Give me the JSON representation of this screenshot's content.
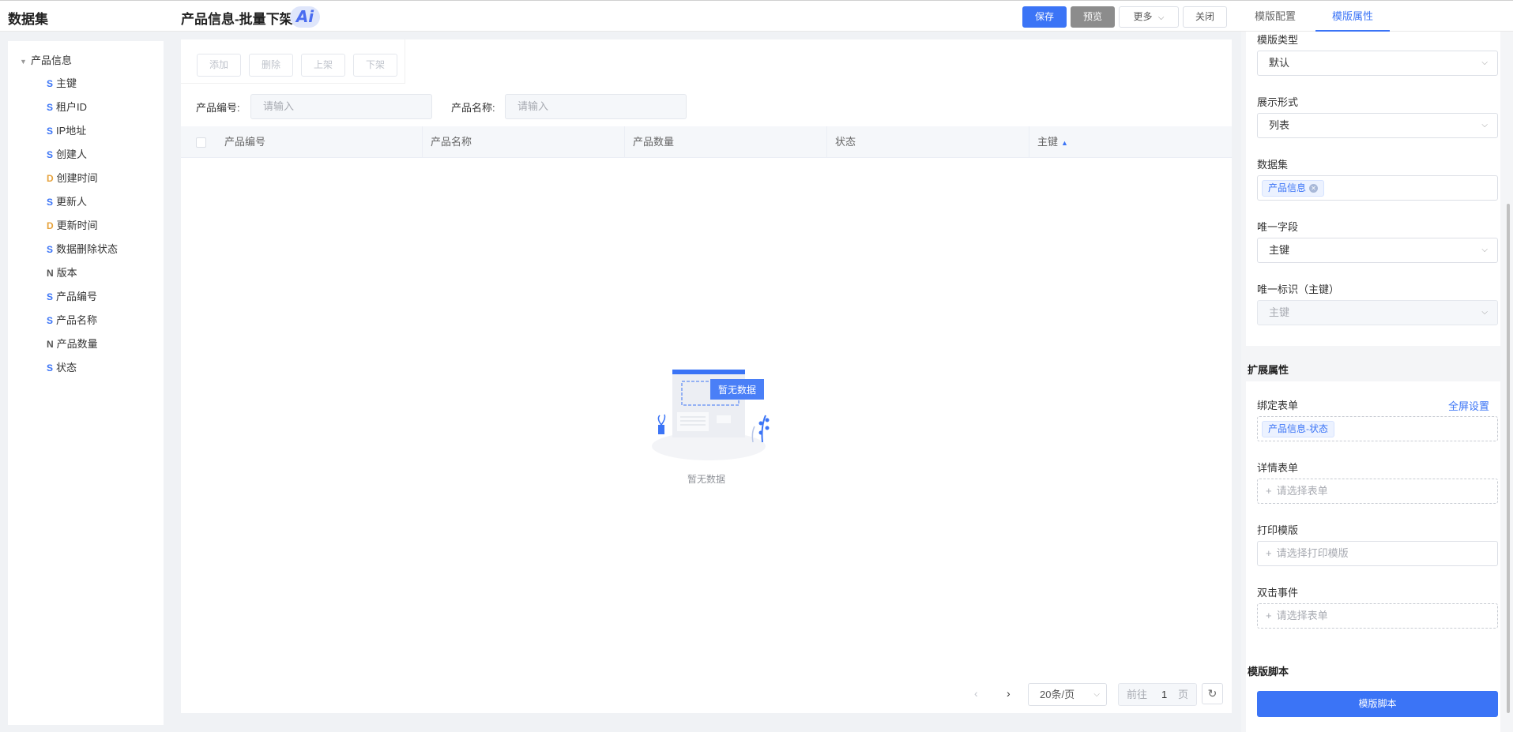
{
  "header": {
    "app_title": "数据集",
    "page_title": "产品信息-批量下架",
    "ai_badge": "Ai",
    "buttons": {
      "save": "保存",
      "preview": "预览",
      "more": "更多",
      "close": "关闭"
    },
    "tabs": {
      "config": "模版配置",
      "props": "模版属性"
    }
  },
  "sidebar": {
    "root": "产品信息",
    "items": [
      {
        "type": "S",
        "label": "主键"
      },
      {
        "type": "S",
        "label": "租户ID"
      },
      {
        "type": "S",
        "label": "IP地址"
      },
      {
        "type": "S",
        "label": "创建人"
      },
      {
        "type": "D",
        "label": "创建时间"
      },
      {
        "type": "S",
        "label": "更新人"
      },
      {
        "type": "D",
        "label": "更新时间"
      },
      {
        "type": "S",
        "label": "数据删除状态"
      },
      {
        "type": "N",
        "label": "版本"
      },
      {
        "type": "S",
        "label": "产品编号"
      },
      {
        "type": "S",
        "label": "产品名称"
      },
      {
        "type": "N",
        "label": "产品数量"
      },
      {
        "type": "S",
        "label": "状态"
      }
    ]
  },
  "main": {
    "actions": {
      "add": "添加",
      "delete": "删除",
      "on_shelf": "上架",
      "off_shelf": "下架"
    },
    "filters": {
      "code_label": "产品编号:",
      "code_placeholder": "请输入",
      "name_label": "产品名称:",
      "name_placeholder": "请输入"
    },
    "columns": [
      "产品编号",
      "产品名称",
      "产品数量",
      "状态",
      "主键"
    ],
    "empty": {
      "badge": "暂无数据",
      "text": "暂无数据"
    },
    "pager": {
      "page_size": "20条/页",
      "goto": "前往",
      "page": "1",
      "page_unit": "页"
    }
  },
  "panel": {
    "template_type": {
      "label": "模版类型",
      "value": "默认"
    },
    "display_mode": {
      "label": "展示形式",
      "value": "列表"
    },
    "dataset": {
      "label": "数据集",
      "tag": "产品信息"
    },
    "unique_field": {
      "label": "唯一字段",
      "value": "主键"
    },
    "unique_id": {
      "label": "唯一标识（主键）",
      "value": "主键"
    },
    "ext_title": "扩展属性",
    "bind_form": {
      "label": "绑定表单",
      "link": "全屏设置",
      "tag": "产品信息-状态"
    },
    "detail_form": {
      "label": "详情表单",
      "placeholder": "请选择表单"
    },
    "print_tpl": {
      "label": "打印模版",
      "placeholder": "请选择打印模版"
    },
    "dblclick": {
      "label": "双击事件",
      "placeholder": "请选择表单"
    },
    "script_title": "模版脚本",
    "script_button": "模版脚本"
  },
  "colors": {
    "accent": "#3b74f6",
    "type_S": "#3b74f6",
    "type_D": "#e6a23c",
    "type_N": "#555555"
  }
}
